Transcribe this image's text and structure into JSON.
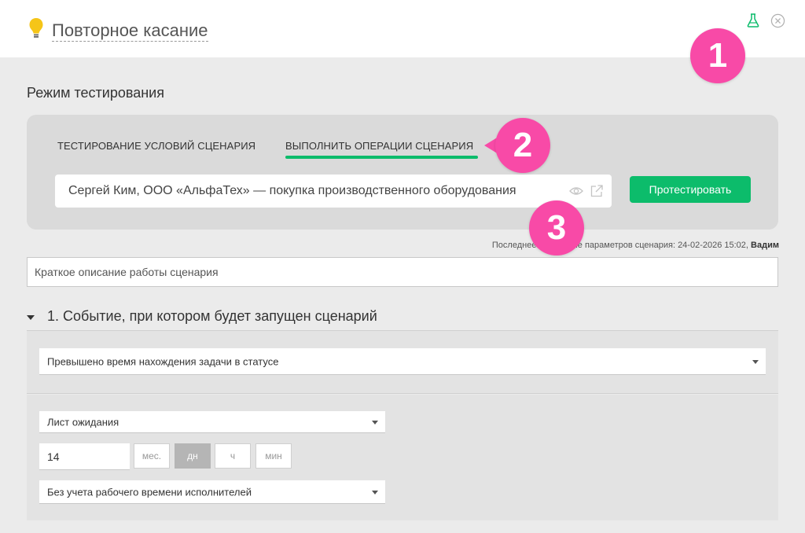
{
  "header": {
    "title": "Повторное касание",
    "icons": [
      "lightbulb-icon",
      "flask-icon",
      "close-circle-icon"
    ]
  },
  "badges": [
    "1",
    "2",
    "3"
  ],
  "testing": {
    "section_title": "Режим тестирования",
    "tabs": [
      {
        "label": "ТЕСТИРОВАНИЕ УСЛОВИЙ СЦЕНАРИЯ",
        "active": false
      },
      {
        "label": "ВЫПОЛНИТЬ ОПЕРАЦИИ СЦЕНАРИЯ",
        "active": true
      }
    ],
    "deal_value": "Сергей Ким, ООО «АльфаТех» — покупка производственного оборудования",
    "test_button": "Протестировать"
  },
  "modified": {
    "text": "Последнее изменение параметров сценария: 24-02-2026 15:02,",
    "user": "Вадим"
  },
  "description": {
    "placeholder": "Краткое описание работы сценария"
  },
  "step1": {
    "title": "1. Событие, при котором будет запущен сценарий",
    "event_select": "Превышено время нахождения задачи в статусе",
    "list_select": "Лист ожидания",
    "duration_value": "14",
    "units": [
      {
        "label": "мес.",
        "active": false
      },
      {
        "label": "дн",
        "active": true
      },
      {
        "label": "ч",
        "active": false
      },
      {
        "label": "мин",
        "active": false
      }
    ],
    "worktime_select": "Без учета рабочего времени исполнителей"
  },
  "colors": {
    "accent_green": "#0cbc6b",
    "badge_pink": "#f84aa7",
    "bulb_yellow": "#f5c518"
  }
}
